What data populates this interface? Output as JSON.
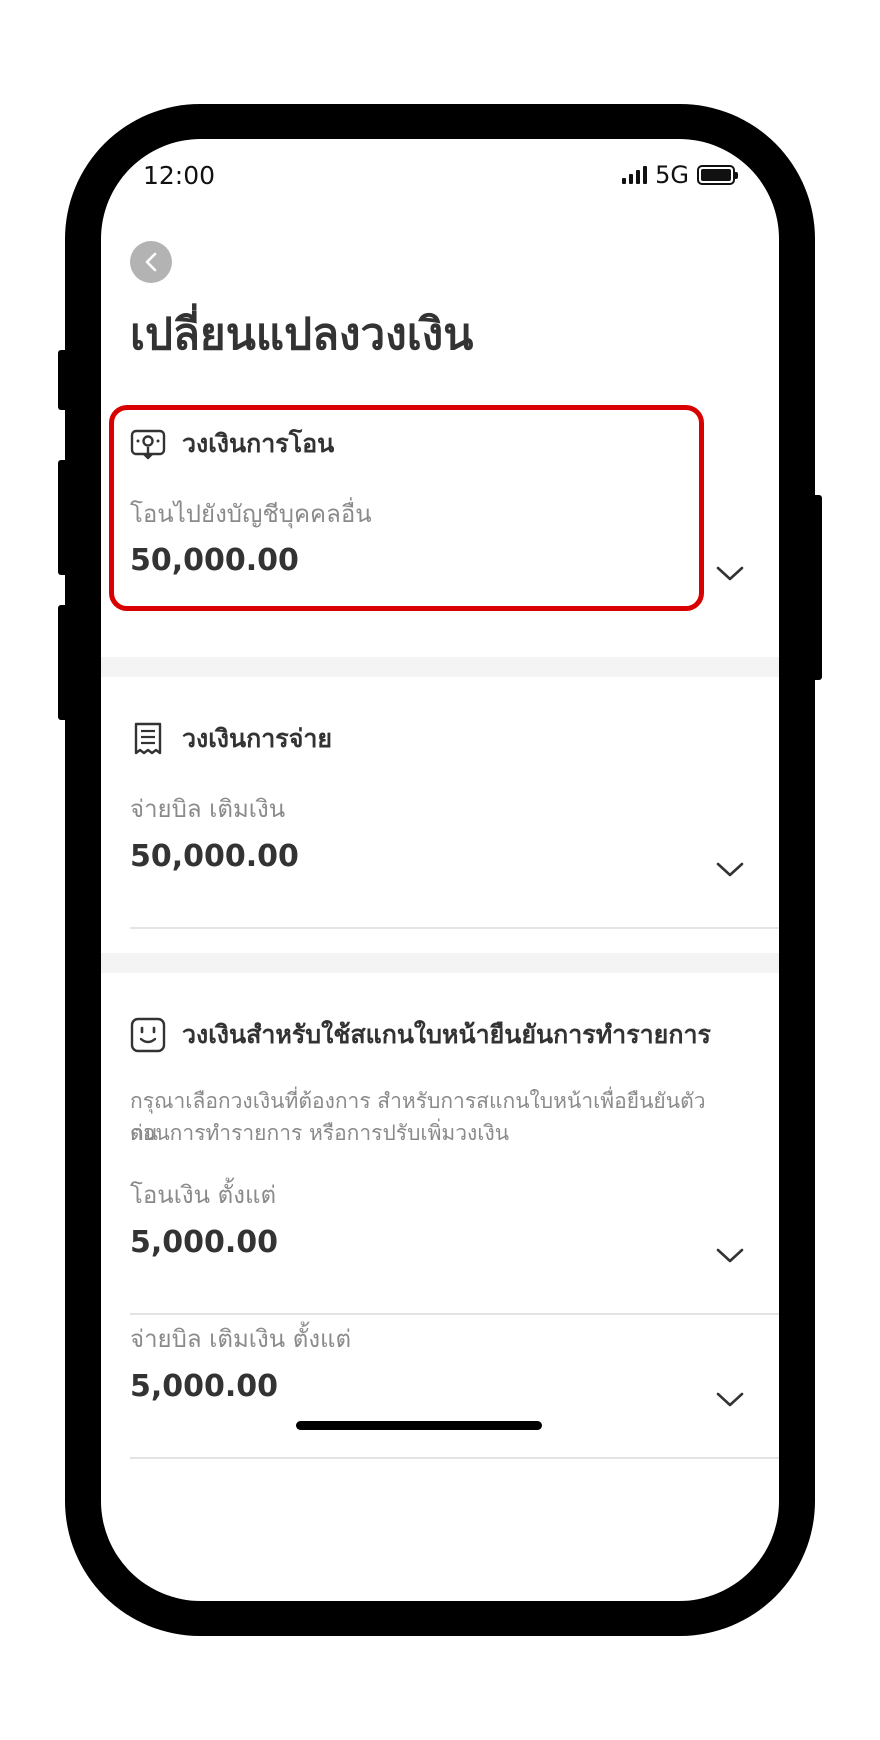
{
  "status_bar": {
    "time": "12:00",
    "network": "5G"
  },
  "header": {
    "title": "เปลี่ยนแปลงวงเงิน"
  },
  "transfer_section": {
    "title": "วงเงินการโอน",
    "field_label": "โอนไปยังบัญชีบุคคลอื่น",
    "value": "50,000.00"
  },
  "payment_section": {
    "title": "วงเงินการจ่าย",
    "field_label": "จ่ายบิล เติมเงิน",
    "value": "50,000.00"
  },
  "face_scan_section": {
    "title": "วงเงินสำหรับใช้สแกนใบหน้ายืนยันการทำรายการ",
    "description_line1": "กรุณาเลือกวงเงินที่ต้องการ สำหรับการสแกนใบหน้าเพื่อยืนยันตัวตน",
    "description_line2": "ก่อนการทำรายการ หรือการปรับเพิ่มวงเงิน",
    "fields": [
      {
        "label": "โอนเงิน ตั้งแต่",
        "value": "5,000.00"
      },
      {
        "label": "จ่ายบิล เติมเงิน ตั้งแต่",
        "value": "5,000.00"
      }
    ]
  },
  "colors": {
    "highlight": "#d90000",
    "text": "#333333",
    "muted": "#8a8a8a",
    "back_button": "#b3b3b3"
  }
}
